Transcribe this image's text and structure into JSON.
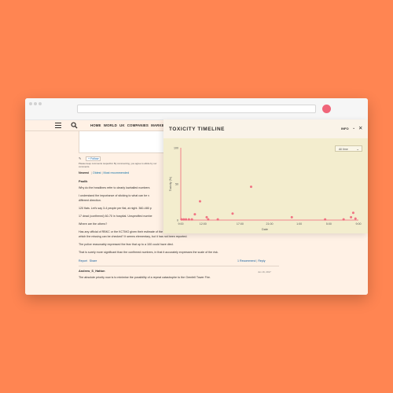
{
  "site": {
    "nav_links": [
      "HOME",
      "WORLD",
      "UK",
      "COMPANIES",
      "MARKETS"
    ],
    "follow_label": "+ Follow",
    "terms_text": "Please keep comments respectful. By commenting, you agree to abide by our",
    "terms_text2": "comments.",
    "sorting": {
      "active": "Newest",
      "oldest": "Oldest",
      "recommended": "Most recommended"
    }
  },
  "comment1": {
    "author": "Paolik",
    "lines": [
      "Why do the headlines refer to clearly lowballed numbers",
      "I understand the importance of sticking to what can be v",
      "different direction.",
      "120 flats. Let's say 3-4 people per flat, at night. 360-480 p",
      "17 dead (confirmed) 60-70 in hospital. Unspecified numbe",
      "Where are the others?",
      "Has any official of RBKC or the KCTMO given their estimate of the numbers in the block, or attempted to run a register against",
      "which the missing can be checked? It seems elementary, but it has not been reported.",
      "The police reasonably expressed the fear that up to a 100 could have died.",
      "That is surely more significant than the confirmed numbers, in that it accurately expresses the scale of the risk."
    ],
    "report": "Report",
    "share": "Share",
    "recommend": "1 Recommend",
    "reply": "Reply"
  },
  "comment2": {
    "author": "Andrew_S_Hatton",
    "date": "Jun 16, 2017",
    "line": "The absolute priority now is to minimise the possibility of a repeat catastrophe to the Grenfell Tower Fire."
  },
  "panel": {
    "title": "TOXICITY TIMELINE",
    "info_label": "INFO",
    "time_filter": "All time",
    "colors": {
      "point": "#F0657A",
      "axis": "#F0657A",
      "background": "#F3EDCE"
    }
  },
  "chart_data": {
    "type": "scatter",
    "title": "",
    "xlabel": "Date",
    "ylabel": "Toxicity (%)",
    "ylim": [
      0,
      100
    ],
    "yticks": [
      "100",
      "50",
      "0"
    ],
    "xticks": [
      "9:00",
      "12:00",
      "17:00",
      "21:00",
      "1:00",
      "5:00",
      "9:00"
    ],
    "xtick_values": [
      0,
      3,
      8,
      12,
      16,
      20,
      24
    ],
    "x_unit": "hours since first tick",
    "points": [
      {
        "x": 0.1,
        "y": 1
      },
      {
        "x": 0.4,
        "y": 1
      },
      {
        "x": 0.7,
        "y": 1
      },
      {
        "x": 1.1,
        "y": 1
      },
      {
        "x": 1.5,
        "y": 1
      },
      {
        "x": 1.9,
        "y": 8
      },
      {
        "x": 2.6,
        "y": 26
      },
      {
        "x": 3.5,
        "y": 4
      },
      {
        "x": 3.7,
        "y": 1
      },
      {
        "x": 5.0,
        "y": 1
      },
      {
        "x": 7.0,
        "y": 9
      },
      {
        "x": 9.5,
        "y": 46
      },
      {
        "x": 15.0,
        "y": 4
      },
      {
        "x": 19.5,
        "y": 1
      },
      {
        "x": 22.0,
        "y": 1
      },
      {
        "x": 23.0,
        "y": 4
      },
      {
        "x": 23.3,
        "y": 10
      },
      {
        "x": 23.6,
        "y": 2
      }
    ]
  }
}
